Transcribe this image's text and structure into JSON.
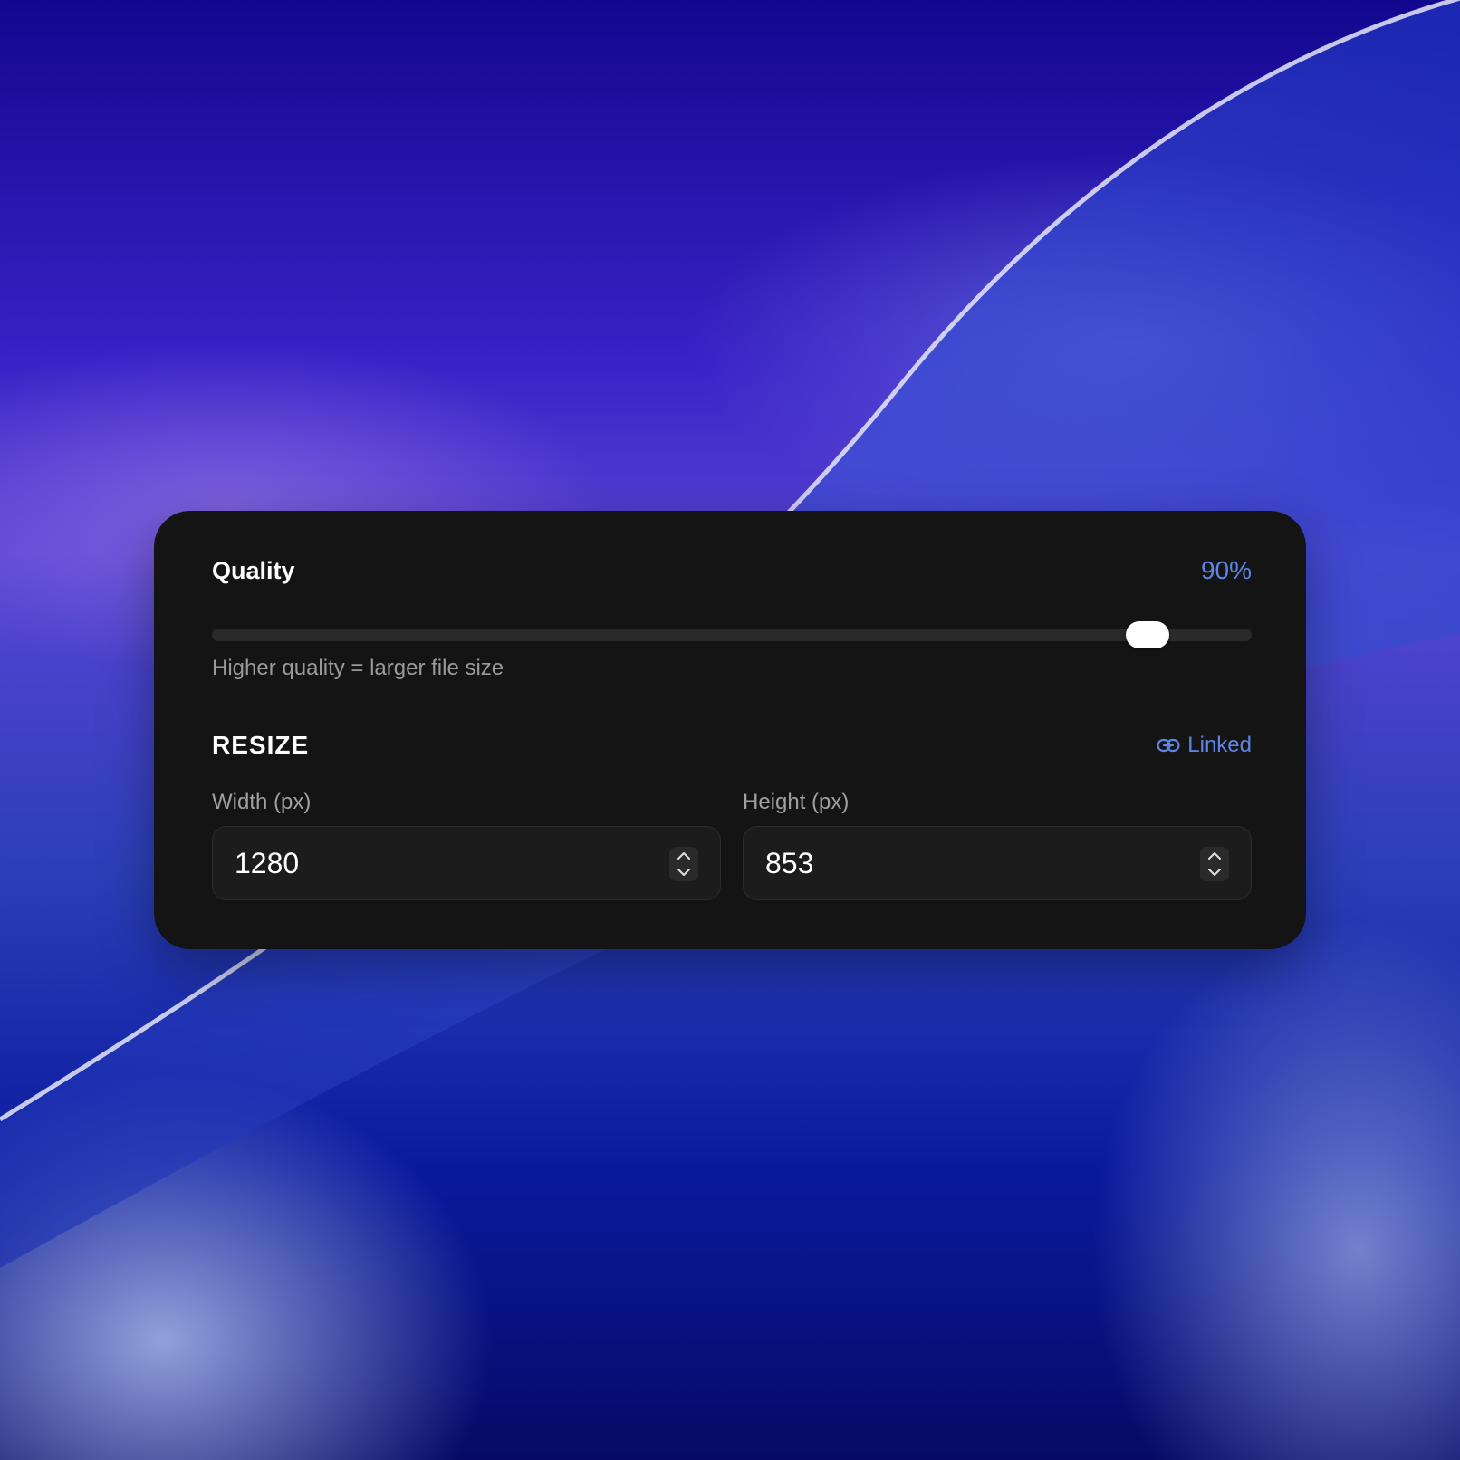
{
  "quality": {
    "label": "Quality",
    "value_text": "90%",
    "value": 90,
    "min": 0,
    "max": 100,
    "hint": "Higher quality = larger file size"
  },
  "resize": {
    "title": "RESIZE",
    "link_label": "Linked",
    "width": {
      "label": "Width (px)",
      "value": "1280"
    },
    "height": {
      "label": "Height (px)",
      "value": "853"
    }
  },
  "colors": {
    "accent": "#5b86e5",
    "panel": "#141414",
    "track": "#2a2a2a"
  },
  "icons": {
    "link": "link-icon",
    "stepper_up": "chevron-up-icon",
    "stepper_down": "chevron-down-icon"
  }
}
